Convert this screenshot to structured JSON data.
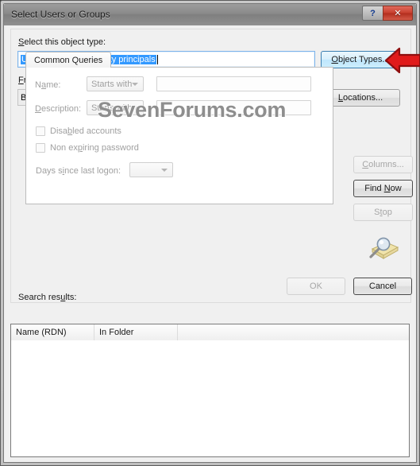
{
  "window": {
    "title": "Select Users or Groups",
    "help_button": "?",
    "close_button": "✕"
  },
  "watermark": "SevenForums.com",
  "object_type": {
    "label_pre": "S",
    "label_mnemonic": "S",
    "label": "Select this object type:",
    "value": "Users or Built-in security principals",
    "button": "Object Types..."
  },
  "location": {
    "label": "From this location:",
    "value": "BRINK-PC",
    "button": "Locations..."
  },
  "tab": {
    "name": "Common Queries"
  },
  "queries": {
    "name_label": "Name:",
    "name_operator": "Starts with",
    "name_value": "",
    "description_label": "Description:",
    "description_operator": "Starts with",
    "description_value": "",
    "disabled_accounts": "Disabled accounts",
    "non_expiring_password": "Non expiring password",
    "days_since_logon_label": "Days since last logon:",
    "days_since_logon_value": ""
  },
  "side_buttons": {
    "columns": "Columns...",
    "find_now": "Find Now",
    "stop": "Stop"
  },
  "results": {
    "label": "Search results:",
    "columns": [
      "Name (RDN)",
      "In Folder",
      ""
    ],
    "rows": []
  },
  "dialog_buttons": {
    "ok": "OK",
    "cancel": "Cancel"
  },
  "icons": {
    "search": "magnifier-folder-icon",
    "annotation_arrow": "red-left-arrow"
  },
  "colors": {
    "selection_blue": "#3399ff",
    "close_red": "#c8402f",
    "annotation_red": "#e01b1b",
    "focus_border": "#3c7fb1"
  }
}
